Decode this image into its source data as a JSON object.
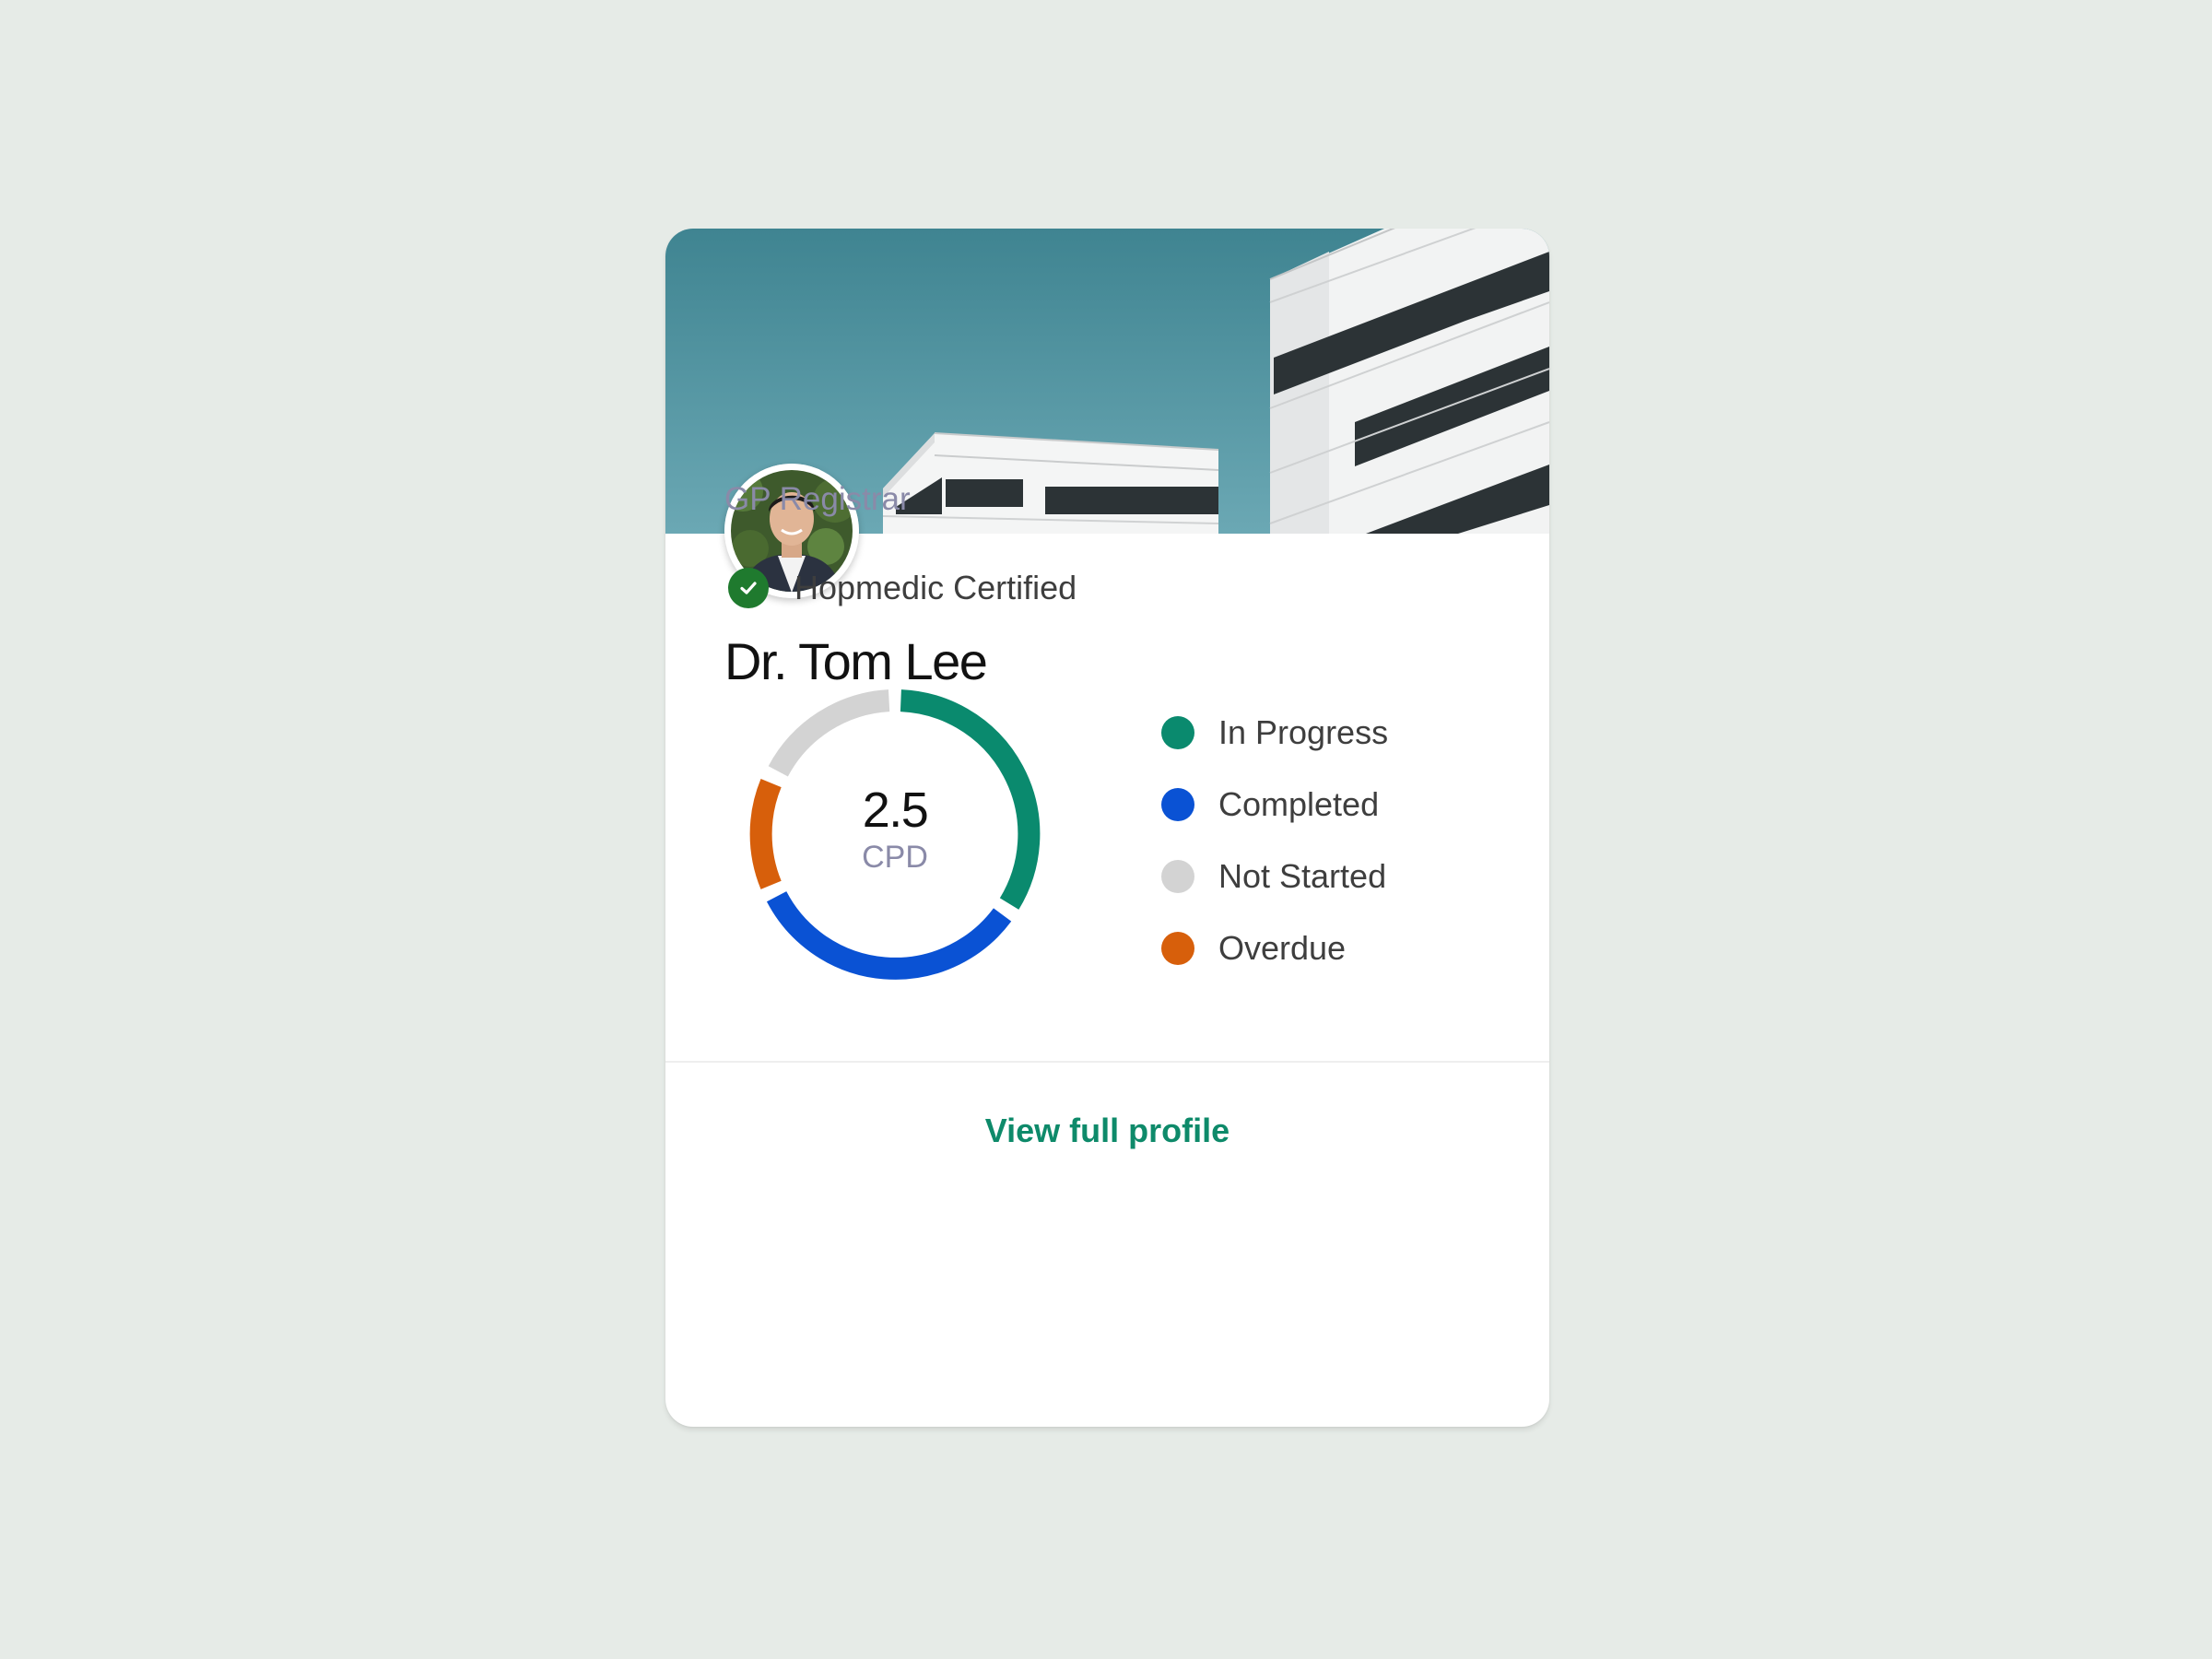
{
  "profile": {
    "name": "Dr. Tom Lee",
    "role": "GP Registrar",
    "certification": "Hopmedic Certified"
  },
  "cpd": {
    "value": "2.5",
    "unit": "CPD"
  },
  "legend": [
    {
      "label": "In Progress",
      "color": "#0A8A6E"
    },
    {
      "label": "Completed",
      "color": "#0A52D4"
    },
    {
      "label": "Not Started",
      "color": "#D3D3D3"
    },
    {
      "label": "Overdue",
      "color": "#D75F0B"
    }
  ],
  "footer": {
    "link_label": "View full profile"
  },
  "colors": {
    "accent": "#0E8A6A",
    "certified_badge": "#1F7A2E",
    "sky_top": "#3F8491",
    "sky_bottom": "#6BA8B4"
  },
  "icons": {
    "certified": "check-circle-icon"
  }
}
